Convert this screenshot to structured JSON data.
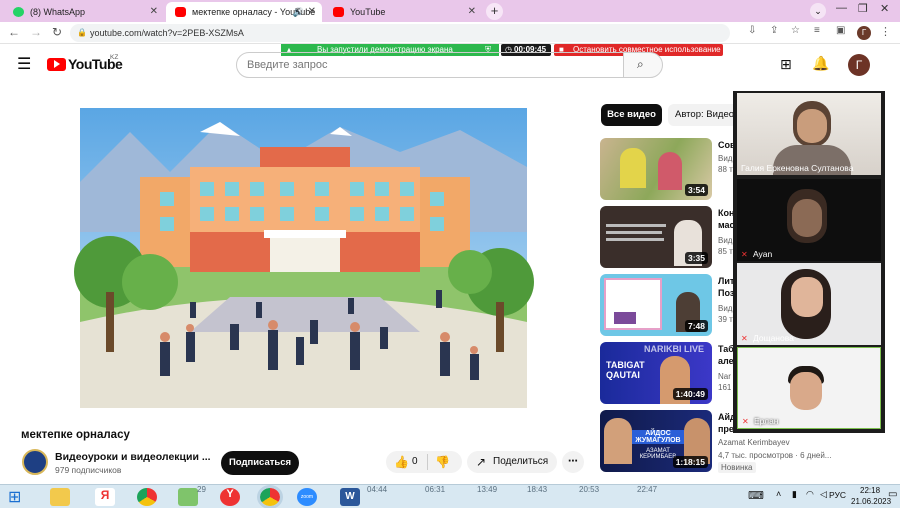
{
  "browser": {
    "tabs": [
      {
        "label": "(8) WhatsApp",
        "favicon": "whatsapp-icon",
        "color": "#25d366"
      },
      {
        "label": "мектепке орналасу - YouTube",
        "favicon": "youtube-icon",
        "color": "#ff0000"
      },
      {
        "label": "YouTube",
        "favicon": "youtube-icon",
        "color": "#ff0000"
      }
    ],
    "url": "youtube.com/watch?v=2PEB-XSZMsA"
  },
  "screenshare": {
    "status": "Вы запустили демонстрацию экрана",
    "timer": "00:09:45",
    "stop_label": "Остановить совместное использование"
  },
  "youtube": {
    "logo": "YouTube",
    "region": "KZ",
    "search_placeholder": "Введите запрос",
    "video_title": "мектепке орналасу",
    "channel": "Видеоуроки и видеолекции ...",
    "subscribers": "979 подписчиков",
    "subscribe_label": "Подписаться",
    "likes": "0",
    "share_label": "Поделиться",
    "filters": [
      "Все видео",
      "Автор: Видео"
    ]
  },
  "recommendations": [
    {
      "title": "Сов",
      "meta": "Вид",
      "meta2": "88 т",
      "duration": "3:54"
    },
    {
      "title": "Кон",
      "title2": "мас",
      "meta": "Вид",
      "meta2": "85 т",
      "duration": "3:35"
    },
    {
      "title": "Лит",
      "title2": "Поз",
      "meta": "Вид",
      "meta2": "39 т",
      "duration": "7:48"
    },
    {
      "title": "Таб",
      "title2": "але",
      "meta": "Nar",
      "meta2": "161",
      "duration": "1:40:49"
    },
    {
      "title": "Айд",
      "title2": "пре",
      "meta": "Azamat Kerimbayev",
      "meta2": "4,7 тыс. просмотров · 6 дней...",
      "badge": "Новинка",
      "duration": "1:18:15"
    }
  ],
  "thumb_texts": {
    "tabigat": "TABIGAT QAUTAI",
    "narikbi": "NARIKBI LIVE",
    "aidos": "АЙДОС ЖУМАГУЛОВ",
    "azamat": "АЗАМАТ КЕРИМБАЕВ"
  },
  "zoom_participants": [
    {
      "name": "Галия Еркеновна Султанова",
      "muted": false
    },
    {
      "name": "Ayan",
      "muted": true
    },
    {
      "name": "Дощанова",
      "muted": true
    },
    {
      "name": "Ерлан",
      "muted": true
    }
  ],
  "taskbar": {
    "language": "РУС",
    "time": "22:18",
    "date": "21.06.2023",
    "timeline": [
      "29",
      "04:44",
      "06:31",
      "13:49",
      "18:43",
      "20:53",
      "22:47"
    ]
  }
}
